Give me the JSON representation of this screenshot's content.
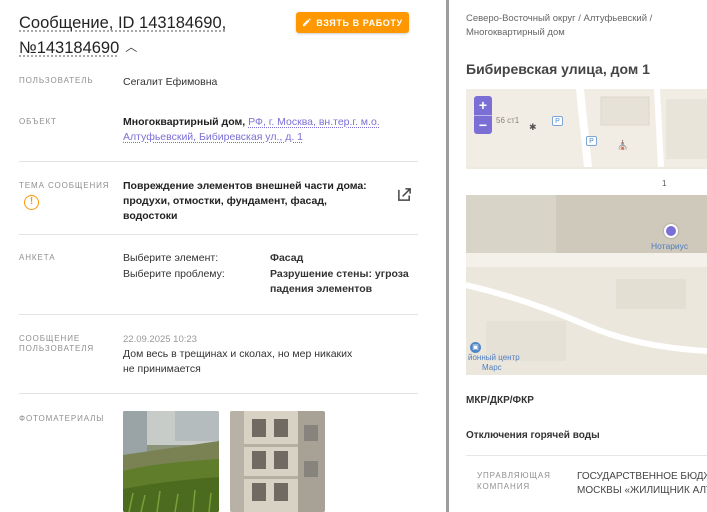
{
  "message": {
    "title_line1": "Сообщение, ID 143184690,",
    "title_line2": "№143184690",
    "take_button": "ВЗЯТЬ В РАБОТУ"
  },
  "fields": {
    "user_label": "ПОЛЬЗОВАТЕЛЬ",
    "user_value": "Сегалит Ефимовна",
    "object_label": "ОБЪЕКТ",
    "object_type": "Многоквартирный дом,",
    "object_link_1": "РФ, г. Москва, вн.тер.г. м.о.",
    "object_link_2": "Алтуфьевский, Бибиревская ул., д. 1",
    "topic_label": "ТЕМА СООБЩЕНИЯ",
    "topic_line1": "Повреждение элементов внешней части дома:",
    "topic_line2": "продухи, отмостки, фундамент, фасад, водостоки",
    "survey_label": "АНКЕТА",
    "survey_q1": "Выберите элемент:",
    "survey_a1": "Фасад",
    "survey_q2": "Выберите проблему:",
    "survey_a2_line1": "Разрушение стены: угроза",
    "survey_a2_line2": "падения элементов",
    "user_msg_label_1": "СООБЩЕНИЕ",
    "user_msg_label_2": "ПОЛЬЗОВАТЕЛЯ",
    "user_msg_date": "22.09.2025 10:23",
    "user_msg_line1": "Дом весь в трещинах и сколах, но мер никаких",
    "user_msg_line2": "не принимается",
    "photos_label": "ФОТОМАТЕРИАЛЫ"
  },
  "right": {
    "breadcrumb_line1": "Северо-Восточный округ / Алтуфьевский /",
    "breadcrumb_line2": "Многоквартирный дом",
    "address": "Бибиревская улица, дом 1",
    "map": {
      "zoom_in": "+",
      "zoom_out": "−",
      "label_building": "56 ст1",
      "label_house": "1",
      "label_poi": "Нотариус",
      "label_center_1": "йонный центр",
      "label_center_2": "Марс",
      "parking": "P"
    },
    "section1": "МКР/ДКР/ФКР",
    "section2": "Отключения горячей воды",
    "mc_label_1": "УПРАВЛЯЮЩАЯ",
    "mc_label_2": "КОМПАНИЯ",
    "mc_line1": "ГОСУДАРСТВЕННОЕ БЮДЖЕ",
    "mc_line2": "МОСКВЫ «ЖИЛИЩНИК АЛТ"
  },
  "colors": {
    "accent": "#ff9800",
    "link": "#7b6fd6",
    "divider": "#9e9e9e"
  }
}
